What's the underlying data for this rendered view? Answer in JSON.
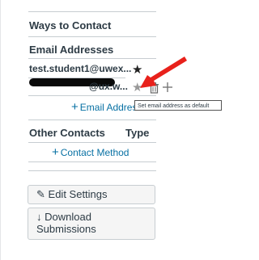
{
  "ways_to_contact": {
    "title": "Ways to Contact",
    "email_header": "Email Addresses",
    "emails": [
      {
        "address": "test.student1@uwex...",
        "star_icon": "star-filled-icon"
      },
      {
        "address": "@ux.w...",
        "star_icon": "star-outline-icon",
        "redacted": true
      }
    ],
    "add_email_label": "Email Address",
    "tooltip": "Set email address as default"
  },
  "other_contacts": {
    "header": "Other Contacts",
    "type_header": "Type",
    "add_contact_method_label": "Contact Method"
  },
  "buttons": {
    "edit_settings": "Edit Settings",
    "download_line1": "Download",
    "download_line2": "Submissions"
  },
  "colors": {
    "link": "#0770a3",
    "arrow": "#e8211b"
  }
}
